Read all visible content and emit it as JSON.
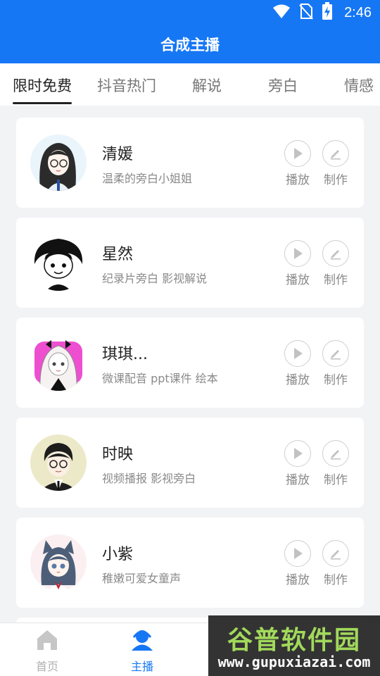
{
  "status_bar": {
    "time": "2:46",
    "icons": [
      "wifi-icon",
      "no-sim-icon",
      "battery-charging-icon"
    ]
  },
  "app_bar": {
    "title": "合成主播"
  },
  "tabs": [
    {
      "label": "限时免费",
      "active": true
    },
    {
      "label": "抖音热门"
    },
    {
      "label": "解说"
    },
    {
      "label": "旁白"
    },
    {
      "label": "情感"
    }
  ],
  "anchors": [
    {
      "name": "清媛",
      "desc": "温柔的旁白小姐姐",
      "play_label": "播放",
      "make_label": "制作",
      "avatar": "girl-with-glasses-avatar"
    },
    {
      "name": "星然",
      "desc": "纪录片旁白  影视解说",
      "play_label": "播放",
      "make_label": "制作",
      "avatar": "boy-black-hair-avatar"
    },
    {
      "name": "琪琪...",
      "desc": "微课配音 ppt课件 绘本",
      "play_label": "播放",
      "make_label": "制作",
      "avatar": "girl-pink-bow-avatar"
    },
    {
      "name": "时映",
      "desc": "视频播报  影视旁白",
      "play_label": "播放",
      "make_label": "制作",
      "avatar": "man-glasses-suit-avatar"
    },
    {
      "name": "小紫",
      "desc": "稚嫩可爱女童声",
      "play_label": "播放",
      "make_label": "制作",
      "avatar": "cat-ear-girl-avatar"
    }
  ],
  "bottom_nav": [
    {
      "label": "首页",
      "icon": "home-icon",
      "active": false
    },
    {
      "label": "主播",
      "icon": "anchor-user-icon",
      "active": true
    }
  ],
  "watermark": {
    "title": "谷普软件园",
    "url": "www.gupuxiazai.com"
  },
  "colors": {
    "primary": "#1677f5",
    "background": "#f2f3f5",
    "card": "#ffffff",
    "text": "#222222",
    "subtext": "#8a8a8a"
  }
}
